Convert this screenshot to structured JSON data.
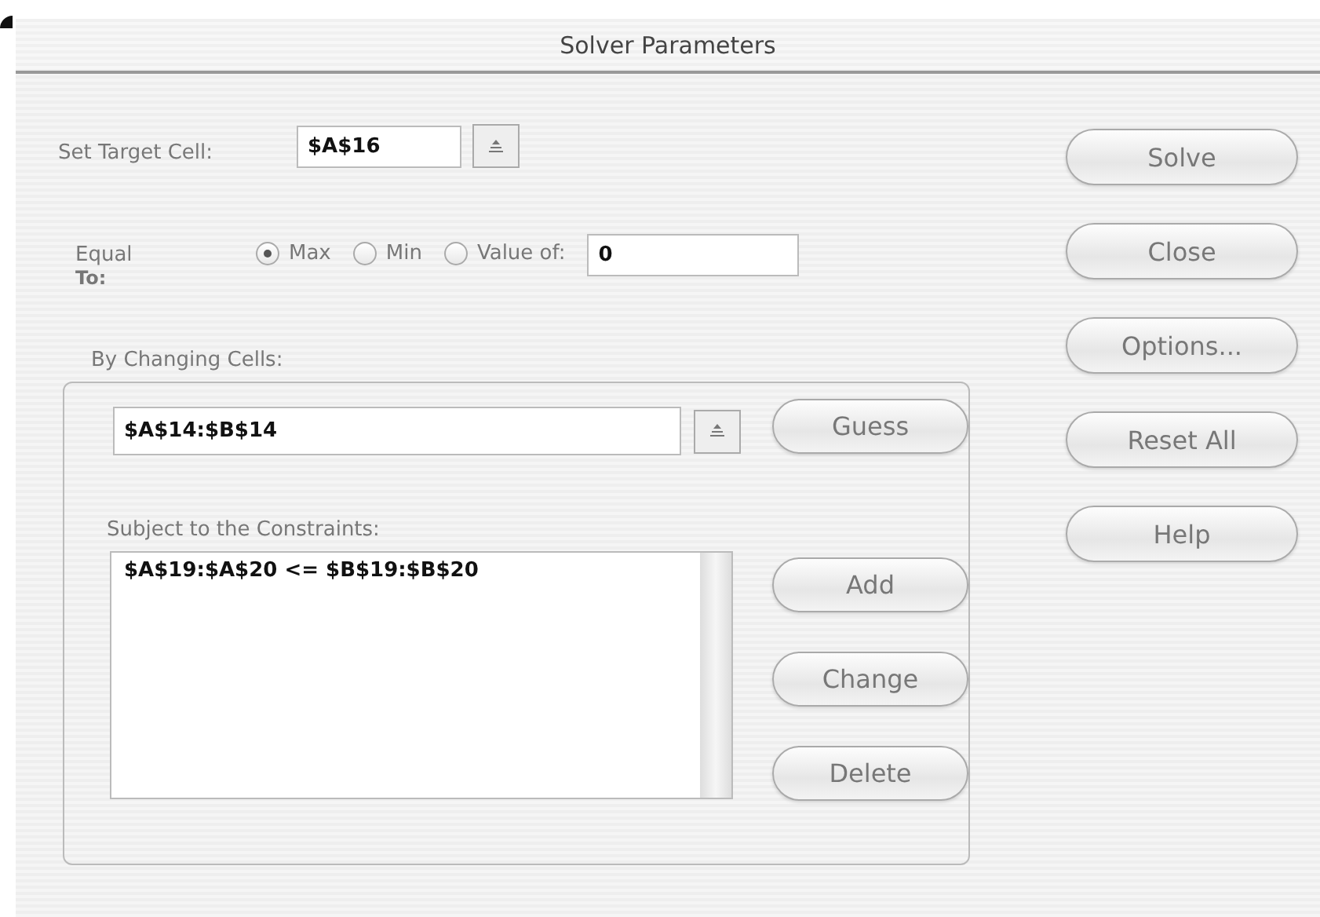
{
  "window": {
    "title": "Solver Parameters"
  },
  "target_cell": {
    "label": "Set Target Cell:",
    "value": "$A$16"
  },
  "equal_to": {
    "label": "Equal",
    "label_2": "To:",
    "value_of": "0",
    "options": [
      {
        "label": "Max",
        "selected": true
      },
      {
        "label": "Min",
        "selected": false
      },
      {
        "label": "Value of:",
        "selected": false
      }
    ]
  },
  "changing_cells": {
    "label": "By Changing Cells:",
    "value": "$A$14:$B$14",
    "guess_button": "Guess"
  },
  "constraints": {
    "label": "Subject to the Constraints:",
    "items": [
      "$A$19:$A$20 <= $B$19:$B$20"
    ],
    "buttons": [
      "Add",
      "Change",
      "Delete"
    ]
  },
  "buttons": [
    "Solve",
    "Close",
    "Options...",
    "Reset All",
    "Help"
  ]
}
